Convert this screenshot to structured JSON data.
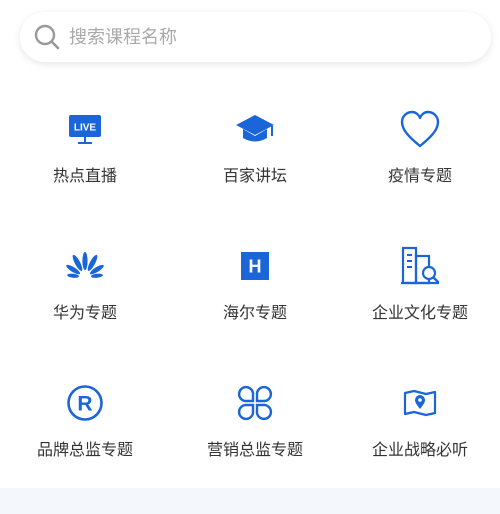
{
  "search": {
    "placeholder": "搜索课程名称"
  },
  "accent_color": "#1a66d9",
  "categories": [
    {
      "label": "热点直播",
      "icon": "live-tv-icon",
      "badge": "LIVE"
    },
    {
      "label": "百家讲坛",
      "icon": "graduation-cap-icon"
    },
    {
      "label": "疫情专题",
      "icon": "heart-icon"
    },
    {
      "label": "华为专题",
      "icon": "huawei-logo-icon"
    },
    {
      "label": "海尔专题",
      "icon": "haier-h-icon",
      "badge": "H"
    },
    {
      "label": "企业文化专题",
      "icon": "building-search-icon"
    },
    {
      "label": "品牌总监专题",
      "icon": "registered-trademark-icon",
      "badge": "R"
    },
    {
      "label": "营销总监专题",
      "icon": "four-leaf-clover-icon"
    },
    {
      "label": "企业战略必听",
      "icon": "map-pin-icon"
    }
  ]
}
